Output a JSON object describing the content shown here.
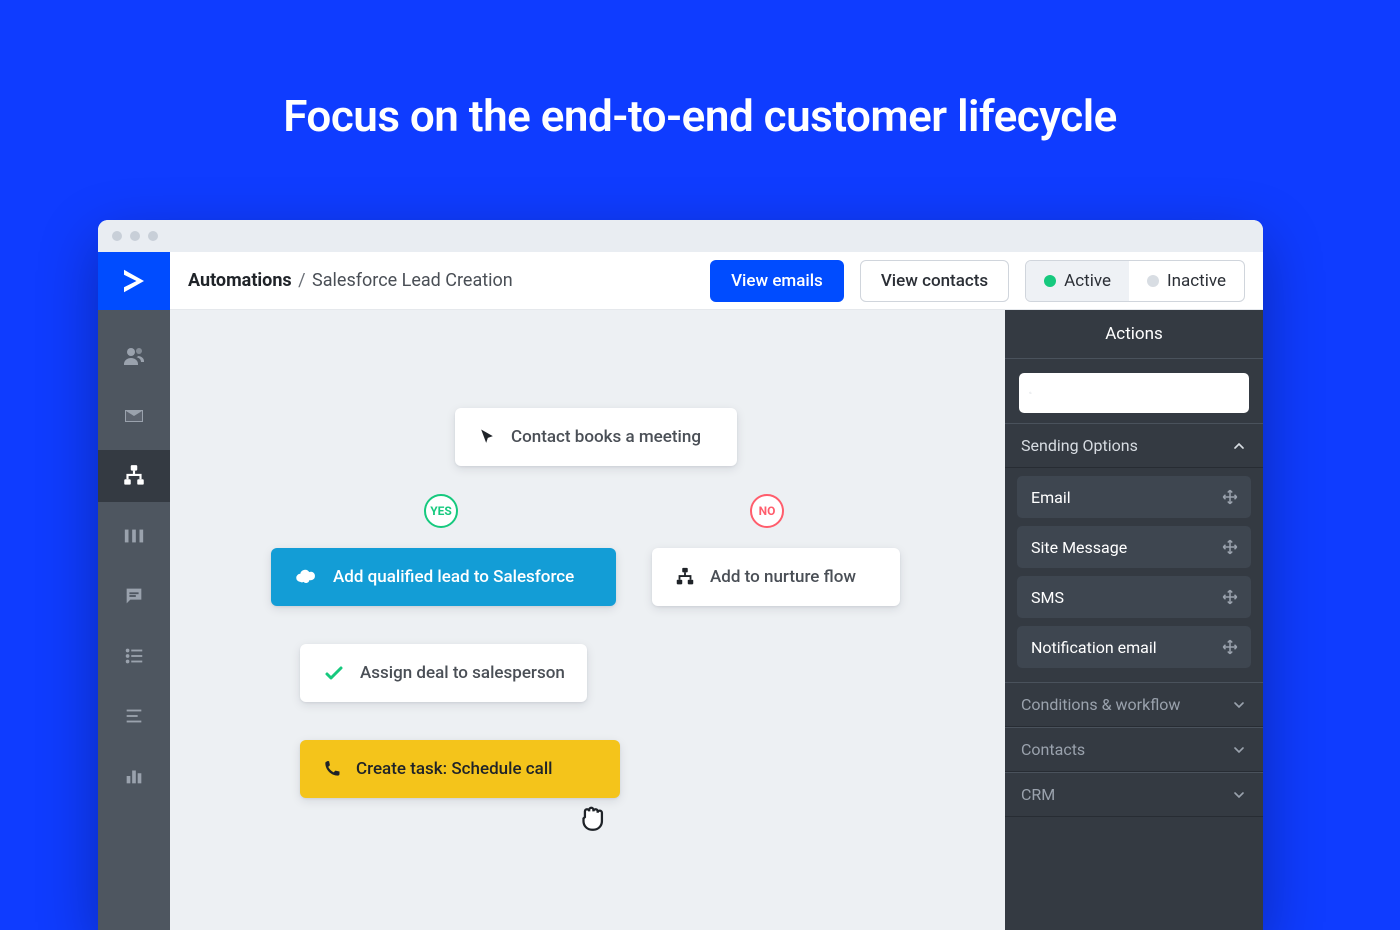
{
  "hero": {
    "title": "Focus on the end-to-end customer lifecycle"
  },
  "breadcrumb": {
    "root": "Automations",
    "sep": "/",
    "leaf": "Salesforce Lead Creation"
  },
  "topbar": {
    "view_emails": "View emails",
    "view_contacts": "View contacts",
    "status": {
      "active": "Active",
      "inactive": "Inactive"
    }
  },
  "leftnav": {
    "items": [
      {
        "name": "contacts-icon"
      },
      {
        "name": "email-icon"
      },
      {
        "name": "automations-icon",
        "active": true
      },
      {
        "name": "deals-icon"
      },
      {
        "name": "conversations-icon"
      },
      {
        "name": "lists-icon"
      },
      {
        "name": "forms-icon"
      },
      {
        "name": "reports-icon"
      }
    ]
  },
  "flow": {
    "start": "Contact books a meeting",
    "yes_label": "YES",
    "no_label": "NO",
    "salesforce": "Add qualified lead to Salesforce",
    "nurture": "Add to nurture flow",
    "assign": "Assign deal to salesperson",
    "task": "Create task: Schedule call"
  },
  "panel": {
    "title": "Actions",
    "search_placeholder": "",
    "sections": {
      "sending": {
        "label": "Sending Options",
        "expanded": true,
        "items": [
          "Email",
          "Site Message",
          "SMS",
          "Notification email"
        ]
      },
      "conditions": {
        "label": "Conditions & workflow",
        "expanded": false
      },
      "contacts": {
        "label": "Contacts",
        "expanded": false
      },
      "crm": {
        "label": "CRM",
        "expanded": false
      }
    }
  }
}
